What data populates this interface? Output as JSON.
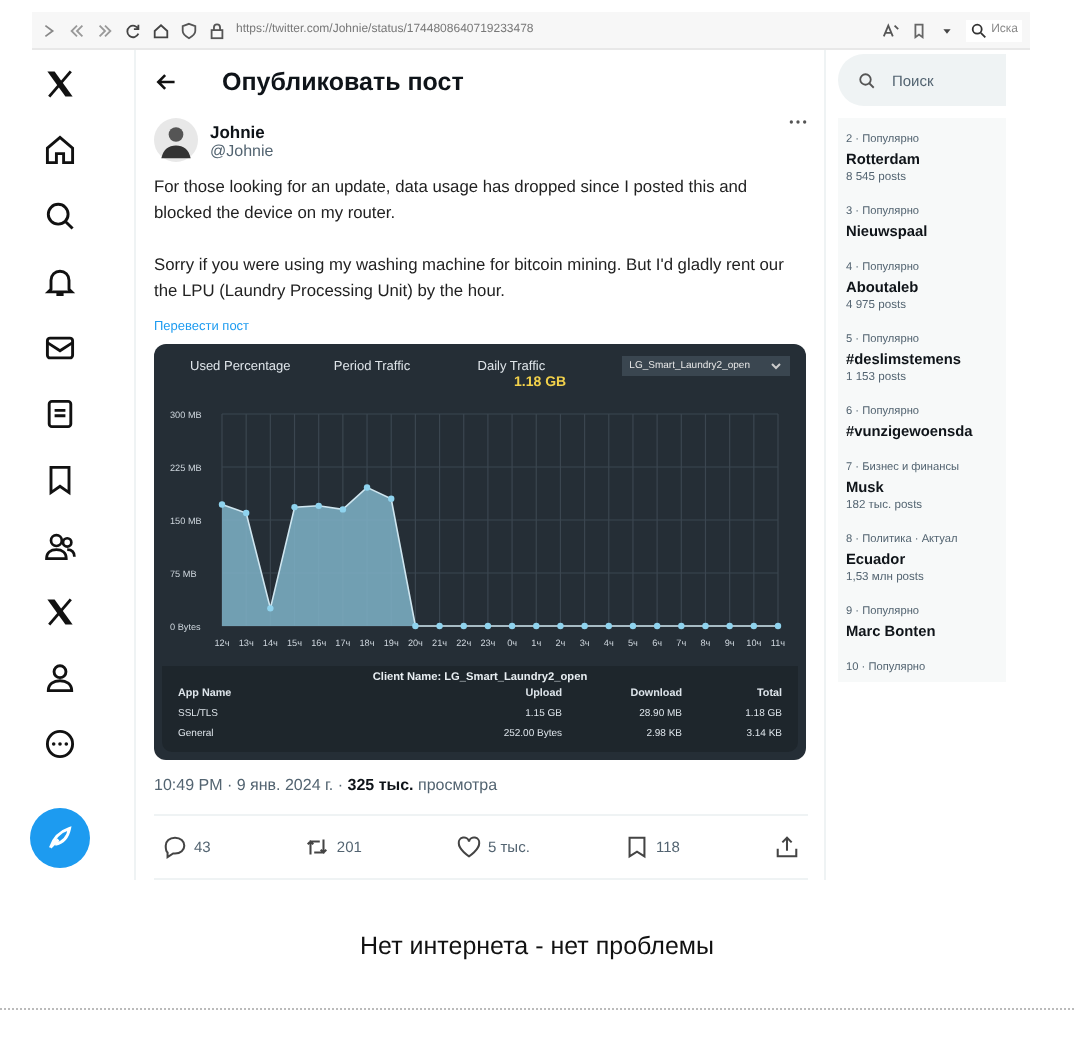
{
  "browser": {
    "url": "https://twitter.com/Johnie/status/1744808640719233478",
    "search_placeholder": "Иска"
  },
  "header": {
    "title": "Опубликовать пост"
  },
  "post": {
    "name": "Johnie",
    "handle": "@Johnie",
    "paragraphs": [
      "For those looking for an update, data usage has dropped since I posted this and blocked the device on my router.",
      "Sorry if you were using my washing machine for bitcoin mining.  But I'd gladly rent our the LPU (Laundry Processing Unit) by the hour."
    ],
    "translate": "Перевести пост",
    "screenshot": {
      "tabs": [
        "Used Percentage",
        "Period Traffic",
        "Daily Traffic"
      ],
      "daily_value": "1.18 GB",
      "device": "LG_Smart_Laundry2_open",
      "chart_data": {
        "type": "area",
        "categories": [
          "12ч",
          "13ч",
          "14ч",
          "15ч",
          "16ч",
          "17ч",
          "18ч",
          "19ч",
          "20ч",
          "21ч",
          "22ч",
          "23ч",
          "0ч",
          "1ч",
          "2ч",
          "3ч",
          "4ч",
          "5ч",
          "6ч",
          "7ч",
          "8ч",
          "9ч",
          "10ч",
          "11ч"
        ],
        "grid": true,
        "series": [
          {
            "color": "#7fb3c8",
            "values": [
              172,
              160,
              25,
              168,
              170,
              165,
              196,
              180,
              0,
              0,
              0,
              0,
              0,
              0,
              0,
              0,
              0,
              0,
              0,
              0,
              0,
              0,
              0,
              0
            ]
          }
        ],
        "ylim": [
          0,
          300
        ],
        "yticks": [
          {
            "value": 0,
            "label": "0 Bytes"
          },
          {
            "value": 75,
            "label": "75 MB"
          },
          {
            "value": 150,
            "label": "150 MB"
          },
          {
            "value": 225,
            "label": "225 MB"
          },
          {
            "value": 300,
            "label": "300 MB"
          }
        ]
      },
      "client": "Client Name: LG_Smart_Laundry2_open",
      "columns": [
        "App Name",
        "Upload",
        "Download",
        "Total"
      ],
      "rows": [
        [
          "SSL/TLS",
          "1.15 GB",
          "28.90 MB",
          "1.18 GB"
        ],
        [
          "General",
          "252.00 Bytes",
          "2.98 KB",
          "3.14 KB"
        ]
      ]
    },
    "meta": "10:49 PM · 9 янв. 2024 г. · **325 тыс.** просмотра",
    "actions": [
      {
        "kind": "reply",
        "count": "43"
      },
      {
        "kind": "repost",
        "count": "201"
      },
      {
        "kind": "like",
        "count": "5 тыс."
      },
      {
        "kind": "bookmark",
        "count": "118"
      },
      {
        "kind": "share"
      }
    ]
  },
  "sidebar": {
    "search_placeholder": "Поиск",
    "trends": [
      {
        "context": "2 · Популярно",
        "name": "Rotterdam",
        "posts": "8 545 posts"
      },
      {
        "context": "3 · Популярно",
        "name": "Nieuwspaal"
      },
      {
        "context": "4 · Популярно",
        "name": "Aboutaleb",
        "posts": "4 975 posts"
      },
      {
        "context": "5 · Популярно",
        "name": "#deslimstemens",
        "posts": "1 153 posts"
      },
      {
        "context": "6 · Популярно",
        "name": "#vunzigewoensda"
      },
      {
        "context": "7 · Бизнес и финансы",
        "name": "Musk",
        "posts": "182 тыс. posts"
      },
      {
        "context": "8 · Политика · Актуал",
        "name": "Ecuador",
        "posts": "1,53 млн posts"
      },
      {
        "context": "9 · Популярно",
        "name": "Marc Bonten"
      },
      {
        "context": "10 · Популярно"
      }
    ]
  },
  "caption": "Нет интернета - нет проблемы"
}
